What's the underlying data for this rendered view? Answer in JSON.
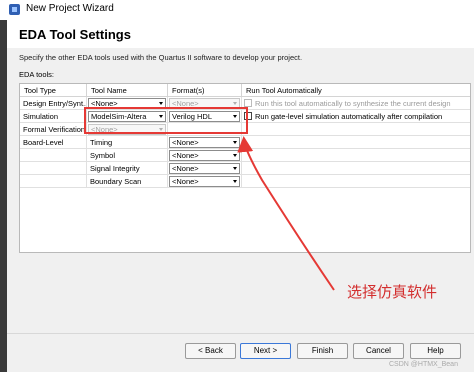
{
  "window": {
    "title": "New Project Wizard"
  },
  "page": {
    "title": "EDA Tool Settings",
    "subtitle": "Specify the other EDA tools used with the Quartus II software to develop your project.",
    "section_label": "EDA tools:"
  },
  "table": {
    "headers": [
      "Tool Type",
      "Tool Name",
      "Format(s)",
      "Run Tool Automatically"
    ],
    "rows": [
      {
        "type": "Design Entry/Synt...",
        "name": "<None>",
        "format": "<None>",
        "run": "Run this tool automatically to synthesize the current design",
        "format_disabled": true,
        "run_disabled": true
      },
      {
        "type": "Simulation",
        "name": "ModelSim-Altera",
        "format": "Verilog HDL",
        "run": "Run gate-level simulation automatically after compilation",
        "format_disabled": false,
        "run_disabled": false
      },
      {
        "type": "Formal Verification",
        "name": "<None>",
        "format": "",
        "run": "",
        "name_disabled": true
      },
      {
        "type": "Board-Level",
        "name": "Timing",
        "format": "<None>",
        "run": ""
      },
      {
        "type": "",
        "name": "Symbol",
        "format": "<None>",
        "run": ""
      },
      {
        "type": "",
        "name": "Signal Integrity",
        "format": "<None>",
        "run": ""
      },
      {
        "type": "",
        "name": "Boundary Scan",
        "format": "<None>",
        "run": ""
      }
    ]
  },
  "annotation": {
    "text": "选择仿真软件",
    "color": "#e53935"
  },
  "buttons": {
    "back": "< Back",
    "next": "Next >",
    "finish": "Finish",
    "cancel": "Cancel",
    "help": "Help"
  },
  "watermark": "CSDN @HTMX_Bean"
}
